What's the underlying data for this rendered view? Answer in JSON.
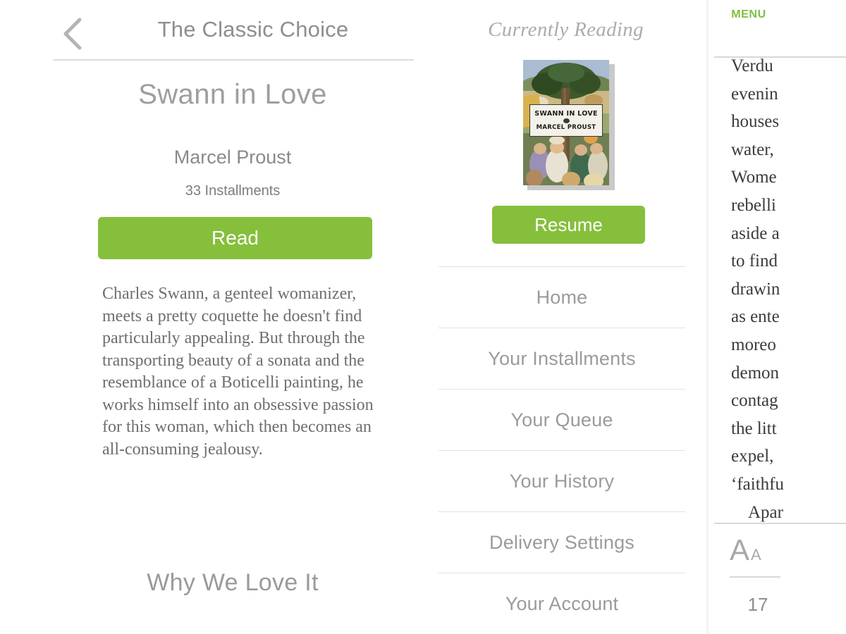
{
  "left": {
    "header": {
      "back_icon": "chevron-left-icon",
      "title": "The Classic Choice"
    },
    "book": {
      "title": "Swann in Love",
      "author": "Marcel Proust",
      "installments": "33 Installments",
      "read_button": "Read",
      "description": "Charles Swann, a genteel womanizer, meets a pretty coquette he doesn't find particularly appealing. But through the transporting beauty of a sonata and the resemblance of a Boticelli painting, he works himself into an obsessive passion for this woman, which then becomes an all-consuming jealousy.",
      "section_heading": "Why We Love It"
    }
  },
  "center": {
    "currently_reading_label": "Currently Reading",
    "cover": {
      "title": "SWANN IN LOVE",
      "author": "MARCEL PROUST",
      "emblem": "oval-emblem-icon"
    },
    "resume_button": "Resume",
    "nav_items": [
      {
        "label": "Home"
      },
      {
        "label": "Your Installments"
      },
      {
        "label": "Your Queue"
      },
      {
        "label": "Your History"
      },
      {
        "label": "Delivery Settings"
      },
      {
        "label": "Your Account"
      }
    ]
  },
  "reader": {
    "menu_icon": "hamburger-menu-icon",
    "menu_label": "MENU",
    "lines": [
      {
        "text": "Verdu",
        "indent": false
      },
      {
        "text": "evenin",
        "indent": false
      },
      {
        "text": "houses",
        "indent": false
      },
      {
        "text": "water,",
        "indent": false
      },
      {
        "text": "Wome",
        "indent": false
      },
      {
        "text": "rebelli",
        "indent": false
      },
      {
        "text": "aside a",
        "indent": false
      },
      {
        "text": "to find",
        "indent": false
      },
      {
        "text": "drawin",
        "indent": false
      },
      {
        "text": "as ente",
        "indent": false
      },
      {
        "text": "moreo",
        "indent": false
      },
      {
        "text": "demon",
        "indent": false
      },
      {
        "text": "contag",
        "indent": false
      },
      {
        "text": "the litt",
        "indent": false
      },
      {
        "text": "expel,",
        "indent": false
      },
      {
        "text": "‘faithfu",
        "indent": false
      },
      {
        "text": "Apar",
        "indent": true
      }
    ],
    "font_size_control": {
      "large": "A",
      "small": "A"
    },
    "page_number": "17"
  },
  "colors": {
    "accent_green": "#86bf3c",
    "menu_green": "#7ec041",
    "text_grey": "#9b9b9b",
    "divider": "#e2e2e2"
  }
}
